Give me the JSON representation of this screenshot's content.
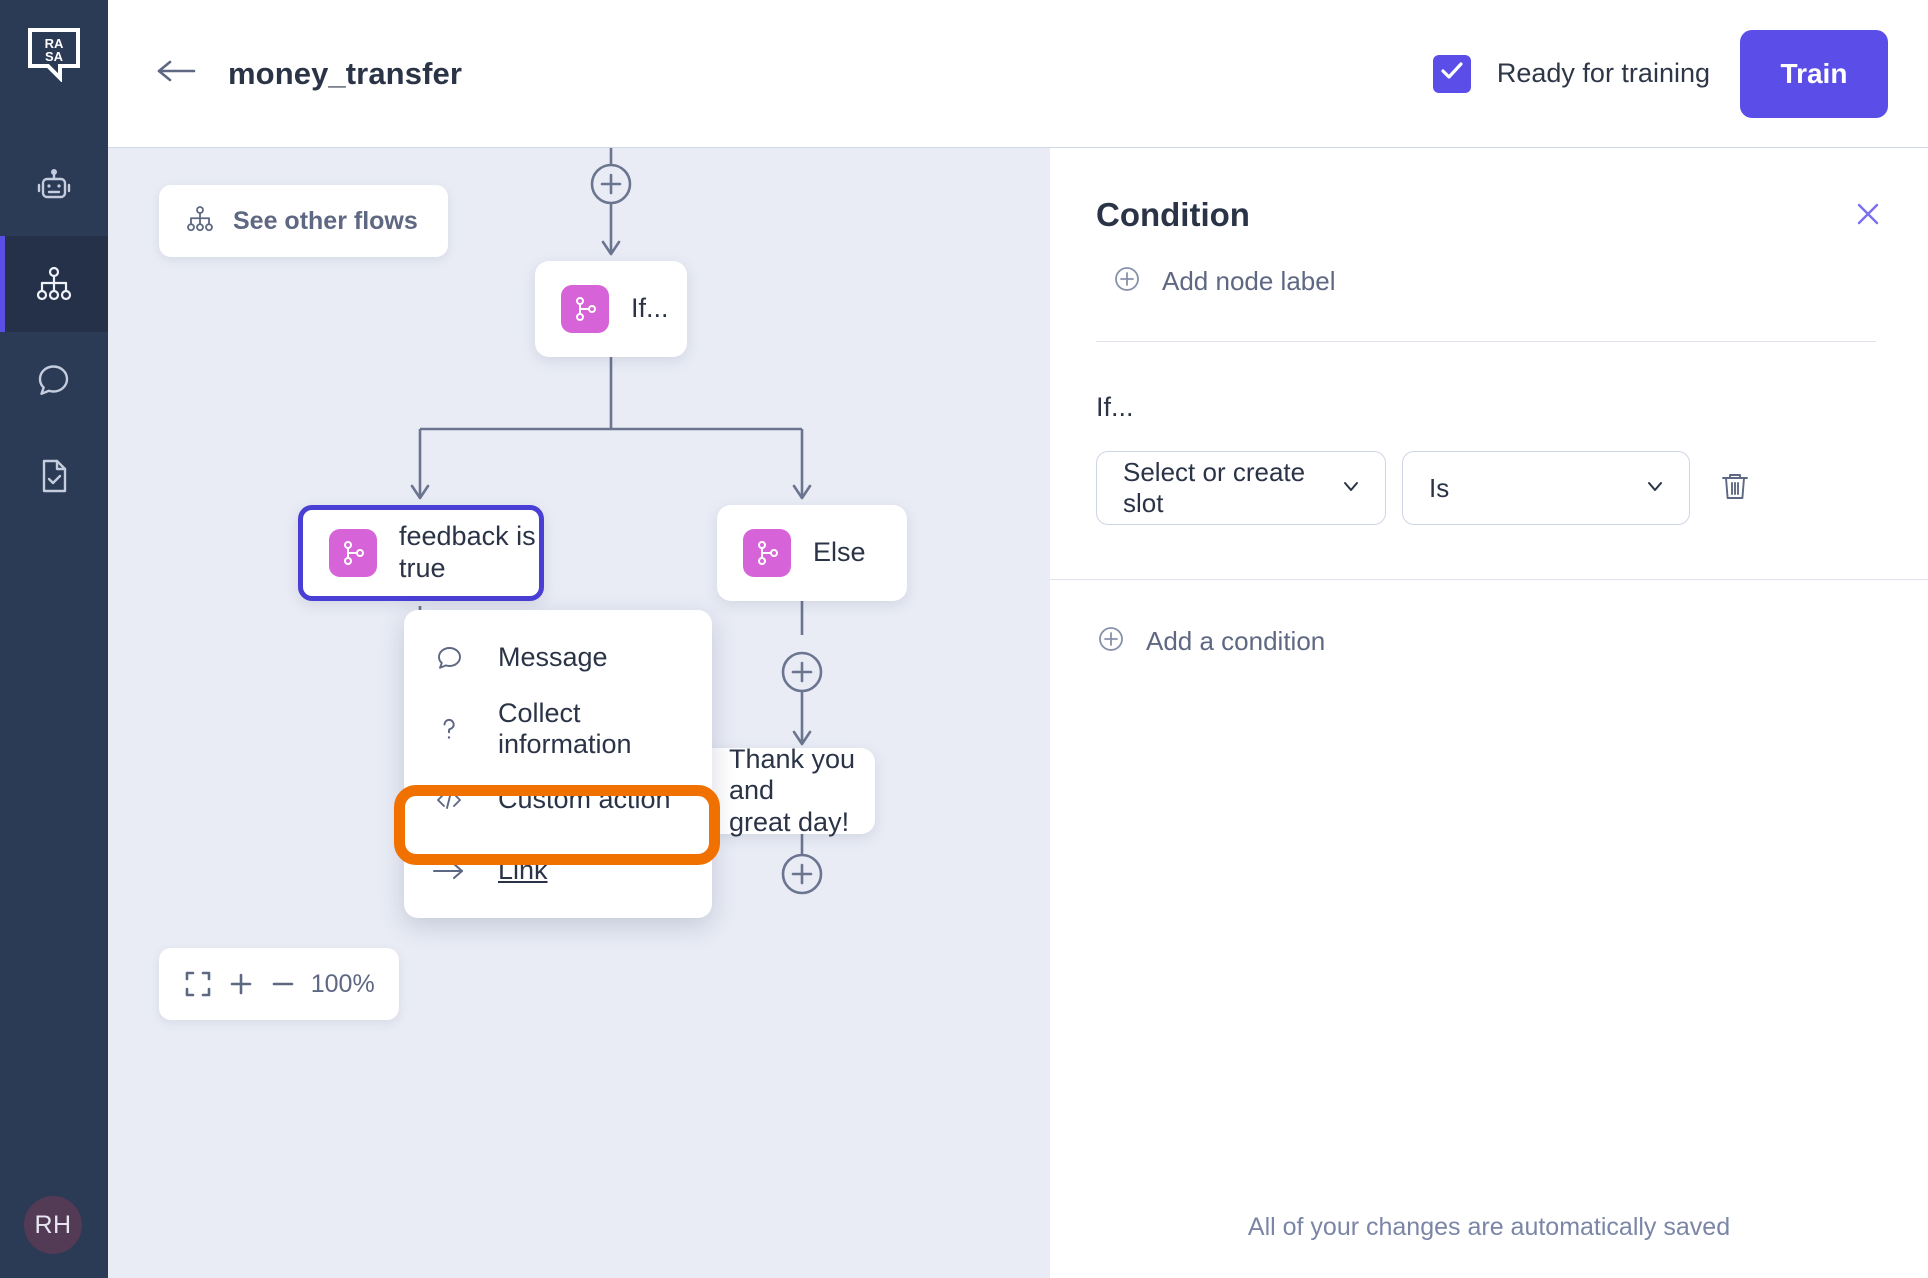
{
  "sidebar": {
    "logo_icon": "rasa-logo",
    "items": [
      {
        "id": "assistant",
        "icon": "robot-icon",
        "active": false
      },
      {
        "id": "flows",
        "icon": "flow-tree-icon",
        "active": true
      },
      {
        "id": "conversations",
        "icon": "speech-bubble-icon",
        "active": false
      },
      {
        "id": "files",
        "icon": "document-check-icon",
        "active": false
      }
    ],
    "avatar_initials": "RH"
  },
  "header": {
    "back_icon": "arrow-left-icon",
    "title": "money_transfer",
    "ready_checkbox_checked": true,
    "ready_label": "Ready for training",
    "train_label": "Train"
  },
  "canvas": {
    "see_other_flows": "See other flows",
    "see_other_flows_icon": "flow-tree-icon",
    "zoom": {
      "fit_icon": "fit-screen-icon",
      "zoom_in_icon": "plus-icon",
      "zoom_out_icon": "minus-icon",
      "level": "100%"
    },
    "nodes": [
      {
        "id": "if",
        "label": "If...",
        "icon": "branch-icon",
        "icon_color": "#d664d8"
      },
      {
        "id": "feedback",
        "label": "feedback is true",
        "icon": "branch-icon",
        "icon_color": "#d664d8",
        "selected": true
      },
      {
        "id": "else",
        "label": "Else",
        "icon": "branch-icon",
        "icon_color": "#d664d8"
      },
      {
        "id": "thankyou",
        "label": "Thank you and\ngreat day!",
        "icon": "message-icon",
        "icon_color": "#2b4fb5"
      }
    ],
    "menu": {
      "items": [
        {
          "label": "Message",
          "icon": "speech-bubble-icon"
        },
        {
          "label": "Collect information",
          "icon": "question-mark-icon"
        },
        {
          "label": "Custom action",
          "icon": "code-brackets-icon"
        },
        {
          "label": "Link",
          "icon": "arrow-right-icon",
          "highlighted": true
        }
      ]
    },
    "highlight_color": "#f07000"
  },
  "panel": {
    "title": "Condition",
    "close_icon": "close-icon",
    "add_node_label": "Add node label",
    "add_node_label_icon": "plus-circle-icon",
    "if_label": "If...",
    "slot_select_value": "Select or create slot",
    "operator_select_value": "Is",
    "chevron_icon": "chevron-down-icon",
    "delete_icon": "trash-icon",
    "add_condition_label": "Add a condition",
    "add_condition_icon": "plus-circle-icon",
    "saved_note": "All of your changes are automatically saved"
  },
  "colors": {
    "accent": "#5b4ee8",
    "selected_node_border": "#4a3fd4",
    "canvas_bg": "#e9ecf5",
    "rail_bg": "#2b3a55",
    "highlight": "#f07000"
  }
}
